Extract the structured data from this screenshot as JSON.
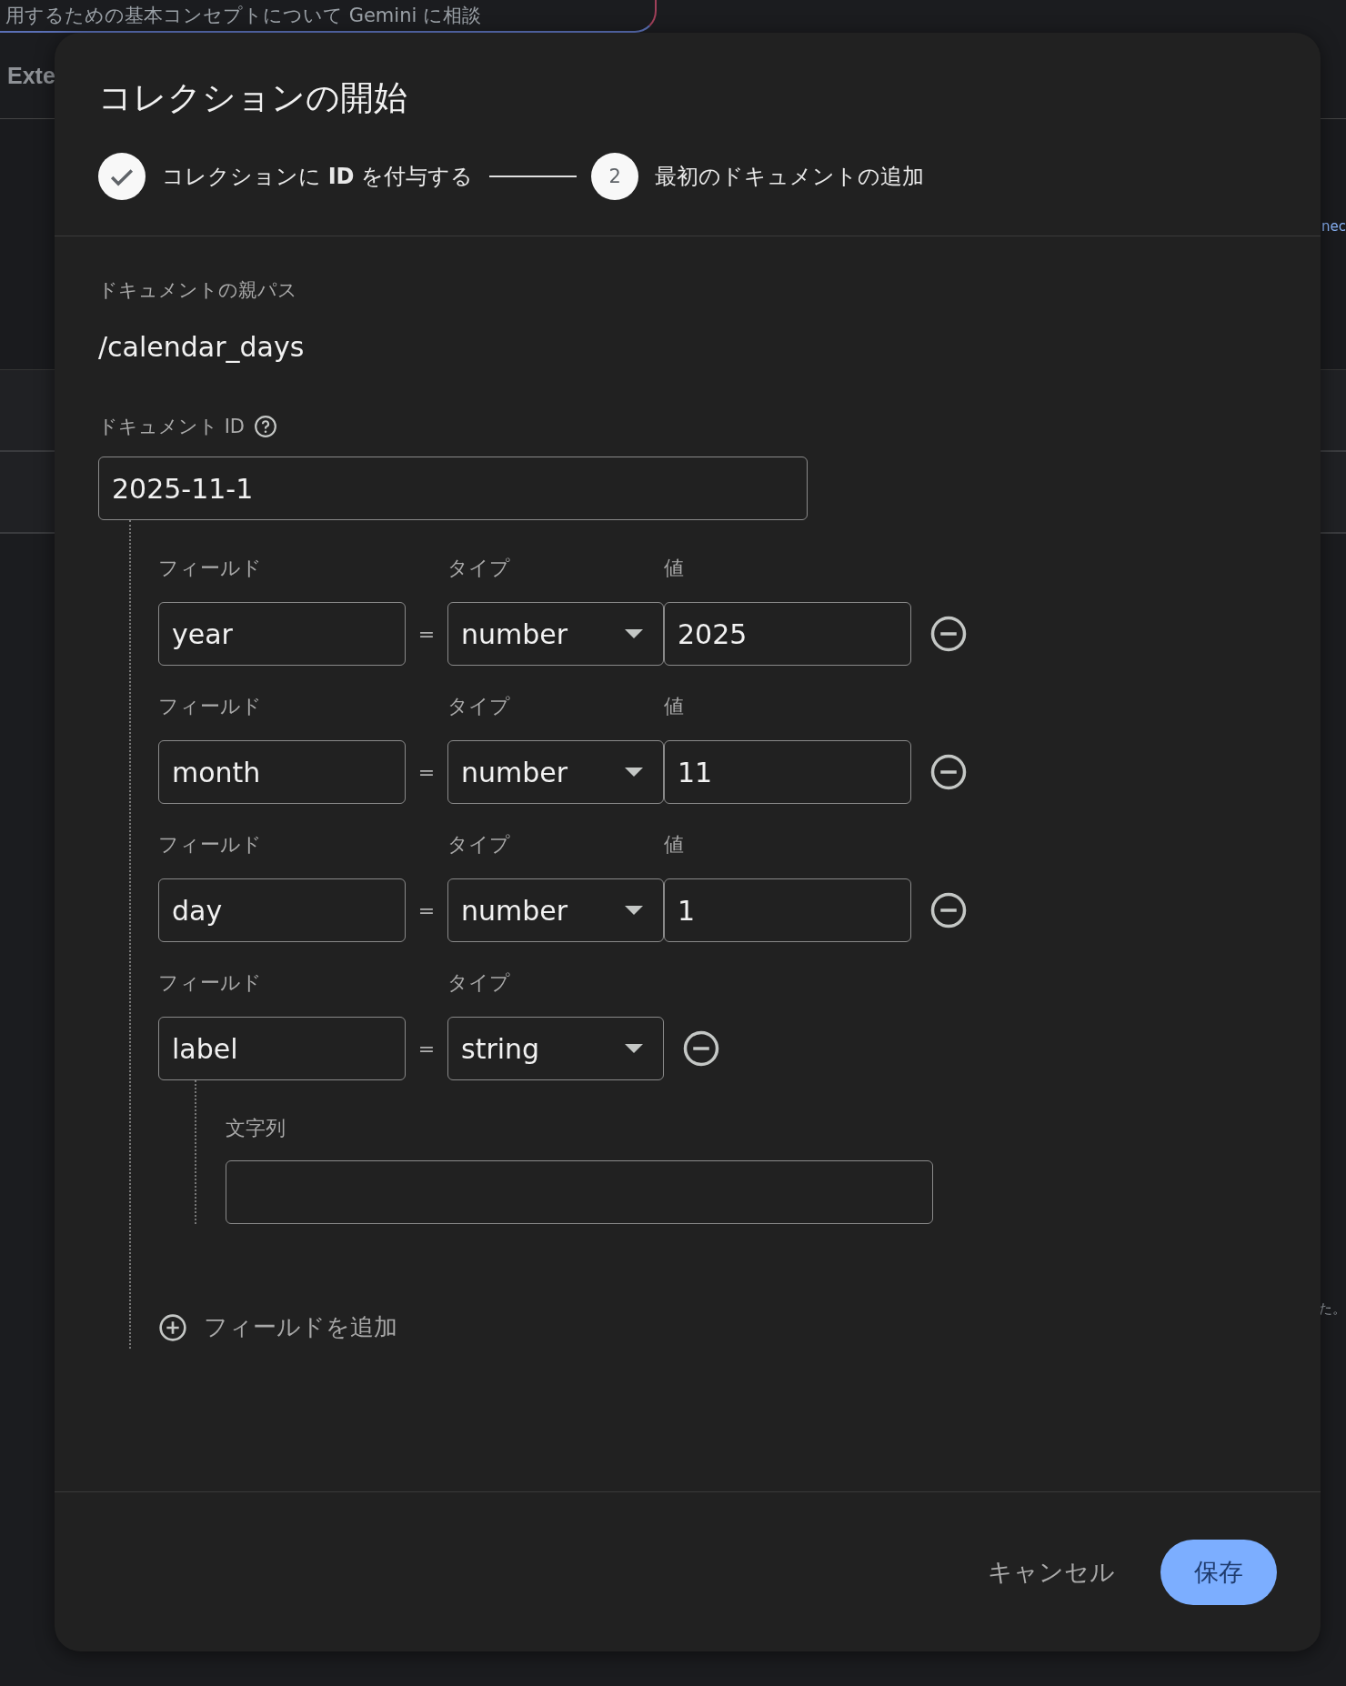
{
  "background": {
    "banner_text": "用するための基本コンセプトについて Gemini に相談",
    "tab_label": "Exte",
    "right_texts": [
      "nec",
      "た。"
    ]
  },
  "dialog": {
    "title": "コレクションの開始",
    "steps": [
      {
        "label": "コレクションに **ID** を付与する",
        "completed": true
      },
      {
        "label": "最初のドキュメントの追加",
        "number": "2",
        "completed": false
      }
    ],
    "parent_path_label": "ドキュメントの親パス",
    "parent_path": "/calendar_days",
    "document_id_label": "ドキュメント ID",
    "document_id": "2025-11-1",
    "fields": [
      {
        "kind": "inline",
        "field_label": "フィールド",
        "type_label": "タイプ",
        "value_label": "値",
        "name": "year",
        "equals": "=",
        "type": "number",
        "value": "2025"
      },
      {
        "kind": "inline",
        "field_label": "フィールド",
        "type_label": "タイプ",
        "value_label": "値",
        "name": "month",
        "equals": "=",
        "type": "number",
        "value": "11"
      },
      {
        "kind": "inline",
        "field_label": "フィールド",
        "type_label": "タイプ",
        "value_label": "値",
        "name": "day",
        "equals": "=",
        "type": "number",
        "value": "1"
      },
      {
        "kind": "nested",
        "field_label": "フィールド",
        "type_label": "タイプ",
        "name": "label",
        "equals": "=",
        "type": "string",
        "nested_label": "文字列"
      }
    ],
    "add_field": "フィールドを追加",
    "buttons": [
      {
        "label": "キャンセル",
        "kind": "text"
      },
      {
        "label": "保存",
        "kind": "filled"
      }
    ]
  }
}
